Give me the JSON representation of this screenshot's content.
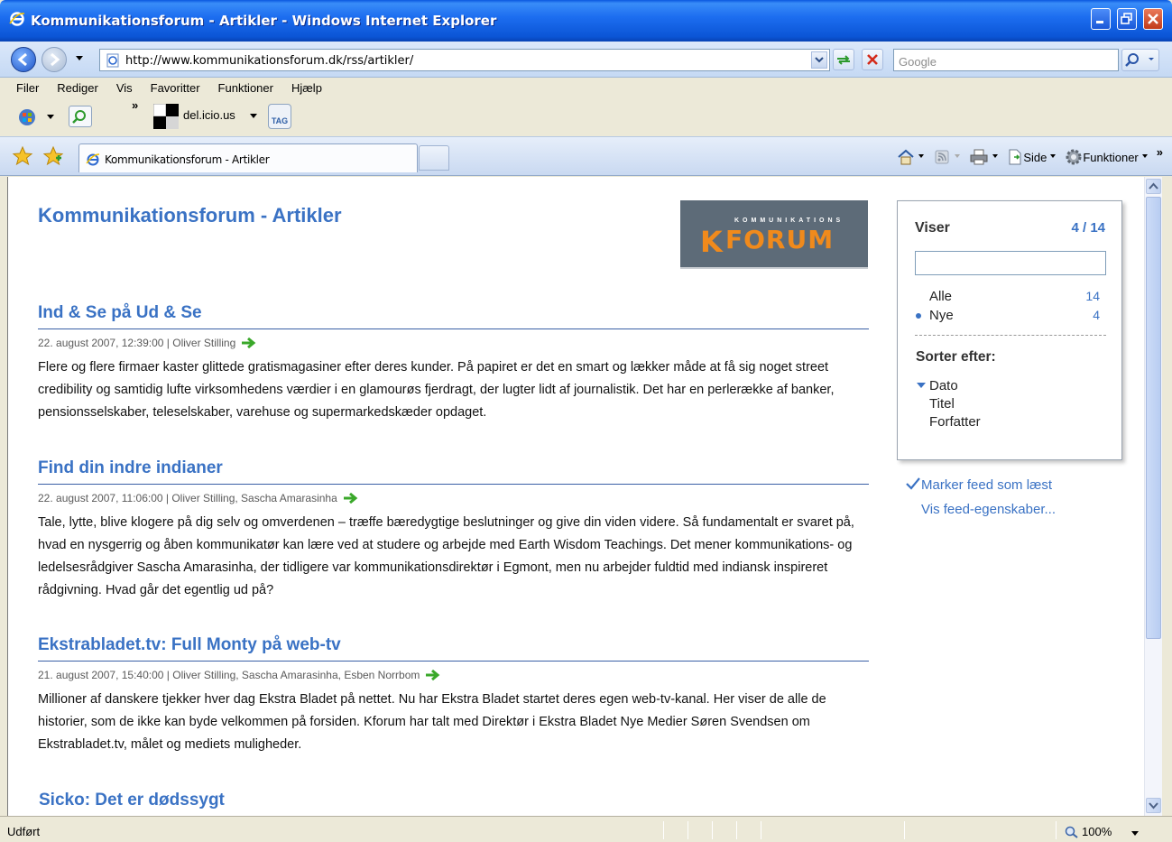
{
  "window": {
    "title": "Kommunikationsforum - Artikler - Windows Internet Explorer"
  },
  "address": {
    "url": "http://www.kommunikationsforum.dk/rss/artikler/",
    "search_placeholder": "Google"
  },
  "menu": {
    "items": [
      "Filer",
      "Rediger",
      "Vis",
      "Favoritter",
      "Funktioner",
      "Hjælp"
    ]
  },
  "toolbar": {
    "chevron": "»",
    "delicious_label": "del.icio.us",
    "tag_label": "TAG"
  },
  "tabs": {
    "active_label": "Kommunikationsforum - Artikler"
  },
  "commandbar": {
    "side_label": "Side",
    "funktioner_label": "Funktioner",
    "chevron": "»"
  },
  "feed": {
    "title": "Kommunikationsforum - Artikler",
    "logo_small": "KOMMUNIKATIONS",
    "logo_big": "FORUM",
    "logo_mark": "K"
  },
  "articles": [
    {
      "title": "Ind & Se på Ud & Se",
      "meta": "22. august 2007, 12:39:00 | Oliver Stilling",
      "body": "Flere og flere firmaer kaster glittede gratismagasiner efter deres kunder. På papiret er det en smart og lækker måde at få sig noget street credibility og samtidig lufte virksomhedens værdier i en glamourøs fjerdragt, der lugter lidt af journalistik. Det har en perlerække af banker, pensionsselskaber, teleselskaber, varehuse og supermarkedskæder opdaget."
    },
    {
      "title": "Find din indre indianer",
      "meta": "22. august 2007, 11:06:00 | Oliver Stilling, Sascha Amarasinha",
      "body": "Tale, lytte, blive klogere på dig selv og omverdenen – træffe bæredygtige beslutninger og give din viden videre. Så fundamentalt er svaret på, hvad en nysgerrig og åben kommunikatør kan lære ved at studere og arbejde med Earth Wisdom Teachings. Det mener kommunikations- og ledelsesrådgiver Sascha Amarasinha, der tidligere var kommunikationsdirektør i Egmont, men nu arbejder fuldtid med indiansk inspireret rådgivning. Hvad går det egentlig ud på?"
    },
    {
      "title": "Ekstrabladet.tv: Full Monty på web-tv",
      "meta": "21. august 2007, 15:40:00 | Oliver Stilling, Sascha Amarasinha, Esben Norrbom",
      "body": "Millioner af danskere tjekker hver dag Ekstra Bladet på nettet. Nu har Ekstra Bladet startet deres egen web-tv-kanal. Her viser de alle de historier, som de ikke kan byde velkommen på forsiden. Kforum har talt med Direktør i Ekstra Bladet Nye Medier Søren Svendsen om Ekstrabladet.tv, målet og mediets muligheder."
    },
    {
      "title": "Sicko: Det er dødssygt",
      "meta": "",
      "body": ""
    }
  ],
  "sidebar": {
    "viser_label": "Viser",
    "count": "4 / 14",
    "alle_label": "Alle",
    "alle_count": "14",
    "nye_label": "Nye",
    "nye_count": "4",
    "sort_heading": "Sorter efter:",
    "sort_options": [
      "Dato",
      "Titel",
      "Forfatter"
    ],
    "mark_read": "Marker feed som læst",
    "feed_props": "Vis feed-egenskaber..."
  },
  "status": {
    "text": "Udført",
    "zoom": "100%"
  },
  "colors": {
    "link_blue": "#3a72c4",
    "arrow_green": "#3aa82a",
    "titlebar_blue": "#0b55d6"
  }
}
